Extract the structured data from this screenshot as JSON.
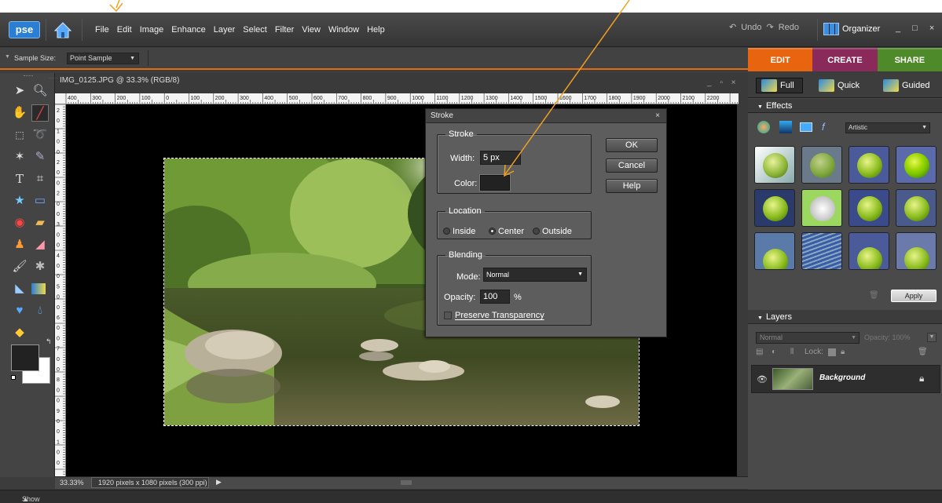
{
  "app": {
    "logo": "pse",
    "menu": [
      "File",
      "Edit",
      "Image",
      "Enhance",
      "Layer",
      "Select",
      "Filter",
      "View",
      "Window",
      "Help"
    ],
    "undo": "Undo",
    "redo": "Redo",
    "organizer": "Organizer",
    "window_controls": "_ □ ×"
  },
  "options_bar": {
    "sample_size_label": "Sample Size:",
    "sample_size_value": "Point Sample"
  },
  "mode_tabs": [
    "EDIT",
    "CREATE",
    "SHARE"
  ],
  "colors": {
    "edit_tab": "#e8640e",
    "create_tab": "#8a2a5a",
    "share_tab": "#4e8a2a",
    "foreground_color": "#222222",
    "background_color": "#ffffff"
  },
  "document": {
    "title": "IMG_0125.JPG @ 33.3% (RGB/8)",
    "window_controls": "_ ▫ ×",
    "ruler_h": [
      "400",
      "300",
      "200",
      "100",
      "0",
      "100",
      "200",
      "300",
      "400",
      "500",
      "600",
      "700",
      "800",
      "900",
      "1000",
      "1100",
      "1200",
      "1300",
      "1400",
      "1500",
      "1600",
      "1700",
      "1800",
      "1900",
      "2000",
      "2100",
      "2200"
    ],
    "ruler_v": [
      "2",
      "0",
      "1",
      "0",
      "0",
      "2",
      "0",
      "0",
      "2",
      "0",
      "0",
      "3",
      "0",
      "0",
      "4",
      "0",
      "0",
      "5",
      "0",
      "0",
      "6",
      "0",
      "0",
      "7",
      "0",
      "0",
      "8",
      "0",
      "0",
      "9",
      "0",
      "0",
      "1",
      "0",
      "0"
    ],
    "zoom": "33.33%",
    "info": "1920 pixels x 1080 pixels (300 ppi)",
    "status_arrow": "▶"
  },
  "project_bin": "Show Project Bin",
  "panel": {
    "modes": [
      "Full",
      "Quick",
      "Guided"
    ],
    "effects_header": "Effects",
    "effects_category": "Artistic",
    "apply": "Apply",
    "layers_header": "Layers",
    "blend_mode": "Normal",
    "opacity_label": "Opacity:",
    "opacity_value": "100%",
    "lock_label": "Lock:",
    "layer_name": "Background"
  },
  "stroke_dialog": {
    "title": "Stroke",
    "close": "×",
    "stroke_group": "Stroke",
    "width_label": "Width:",
    "width_value": "5 px",
    "color_label": "Color:",
    "color_swatch": "#222222",
    "location_group": "Location",
    "location_options": [
      "Inside",
      "Center",
      "Outside"
    ],
    "location_selected": "Center",
    "blending_group": "Blending",
    "mode_label": "Mode:",
    "mode_value": "Normal",
    "opacity_label": "Opacity:",
    "opacity_value": "100",
    "opacity_unit": "%",
    "preserve_transparency": "Preserve Transparency",
    "ok": "OK",
    "cancel": "Cancel",
    "help": "Help"
  }
}
